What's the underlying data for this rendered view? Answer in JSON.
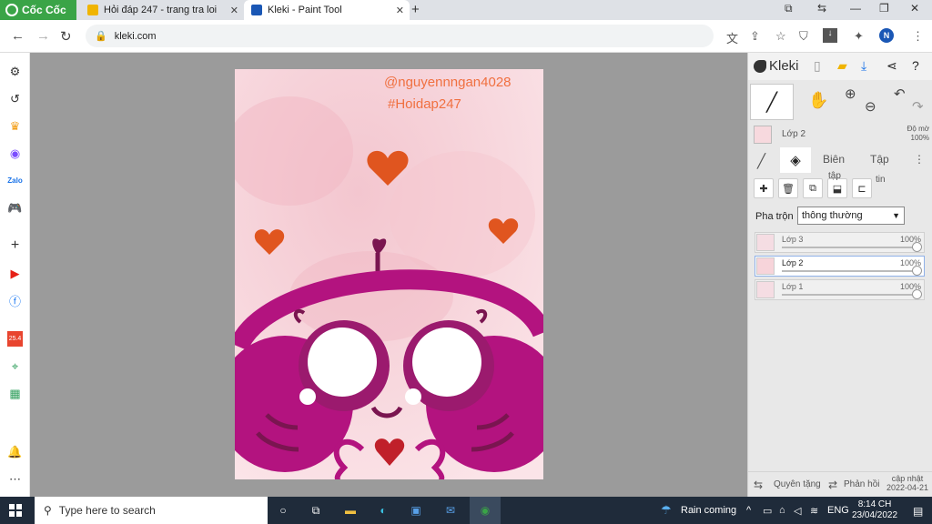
{
  "browser": {
    "brand": "Cốc Cốc",
    "tabs": [
      {
        "title": "Hỏi đáp 247 - trang tra loi"
      },
      {
        "title": "Kleki - Paint Tool"
      }
    ],
    "url": "kleki.com",
    "profile_initial": "N"
  },
  "canvas": {
    "watermark_user": "@nguyennngan4028",
    "watermark_tag": "#Hoidap247"
  },
  "kleki": {
    "title": "Kleki",
    "current_layer": {
      "name": "Lớp 2",
      "opacity_label": "Độ mờ",
      "opacity_value": "100%"
    },
    "subtabs": {
      "edit": "Biên",
      "file": "Tập",
      "edit_sub": "tập",
      "file_sub": "tin"
    },
    "blend_label": "Pha trộn",
    "blend_value": "thông thường",
    "layers": [
      {
        "name": "Lớp 3",
        "opacity": "100%",
        "selected": false
      },
      {
        "name": "Lớp 2",
        "opacity": "100%",
        "selected": true
      },
      {
        "name": "Lớp 1",
        "opacity": "100%",
        "selected": false
      }
    ],
    "footer": {
      "rotate": "Quyên tặng",
      "feedback": "Phản hồi",
      "update_line1": "cập nhật",
      "update_line2": "2022-04-21"
    }
  },
  "taskbar": {
    "search_placeholder": "Type here to search",
    "weather": "Rain coming",
    "language": "ENG",
    "time": "8:14 CH",
    "date": "23/04/2022"
  },
  "colors": {
    "brand_green": "#3aa447",
    "canvas_bg": "#f7d4da",
    "magenta": "#b3137f",
    "heart_orange": "#e0551f",
    "taskbar": "#1f2b3a"
  }
}
